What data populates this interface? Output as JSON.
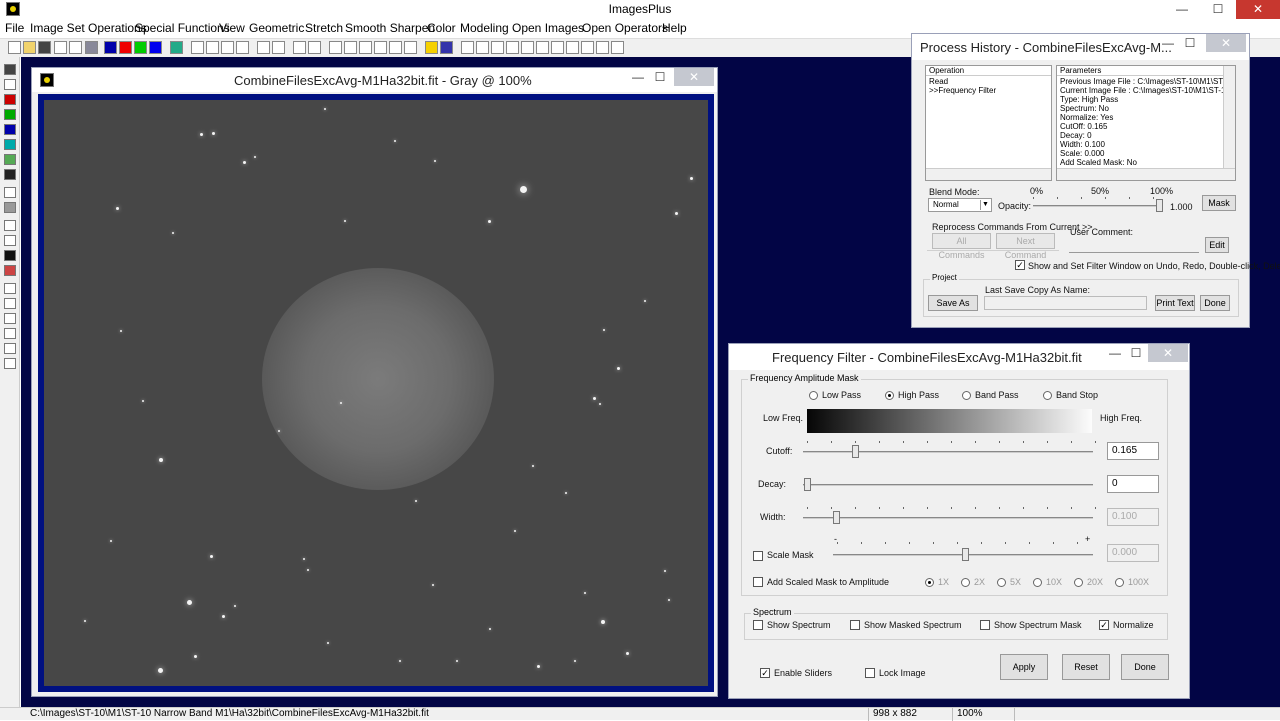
{
  "app": {
    "title": "ImagesPlus",
    "min": "—",
    "max": "☐",
    "close": "✕"
  },
  "menu": [
    "File",
    "Image Set Operations",
    "Special Functions",
    "View",
    "Geometric",
    "Stretch",
    "Smooth Sharpen",
    "Color",
    "Modeling",
    "Open Images",
    "Open Operators",
    "Help"
  ],
  "image_window": {
    "title": "CombineFilesExcAvg-M1Ha32bit.fit - Gray @ 100%",
    "min": "—",
    "max": "☐",
    "close": "✕"
  },
  "process_history": {
    "title": "Process History - CombineFilesExcAvg-M...",
    "min": "—",
    "max": "☐",
    "close": "✕",
    "operation_header": "Operation",
    "operations": [
      "Read",
      ">>Frequency Filter"
    ],
    "parameters_header": "Parameters",
    "parameters": [
      "Previous Image File : C:\\Images\\ST-10\\M1\\ST-10 N",
      "Current Image File : C:\\Images\\ST-10\\M1\\ST-10 N",
      "Type: High Pass",
      "Spectrum: No",
      "Normalize: Yes",
      "CutOff: 0.165",
      "Decay: 0",
      "Width: 0.100",
      "Scale: 0.000",
      "Add Scaled Mask: No"
    ],
    "blend_mode_label": "Blend Mode:",
    "blend_mode_value": "Normal",
    "opacity_label": "Opacity:",
    "opacity_scale": [
      "0%",
      "50%",
      "100%"
    ],
    "opacity_value": "1.000",
    "opacity_fraction": 1.0,
    "mask_button": "Mask",
    "reprocess_label": "Reprocess Commands From Current >>",
    "all_commands": "All Commands",
    "next_command": "Next Command",
    "user_comment_label": "User Comment:",
    "edit_button": "Edit",
    "show_set_filter_label": "Show and Set Filter Window on Undo, Redo, Double-click, Delete",
    "project_label": "Project",
    "last_save_label": "Last Save Copy As Name:",
    "save_as": "Save As",
    "print_text": "Print Text",
    "done": "Done"
  },
  "frequency_filter": {
    "title": "Frequency Filter - CombineFilesExcAvg-M1Ha32bit.fit",
    "min": "—",
    "max": "☐",
    "close": "✕",
    "mask_group_label": "Frequency Amplitude Mask",
    "filter_types": [
      "Low Pass",
      "High Pass",
      "Band Pass",
      "Band Stop"
    ],
    "selected_type": "High Pass",
    "low_freq_label": "Low Freq.",
    "high_freq_label": "High Freq.",
    "cutoff_label": "Cutoff:",
    "cutoff_value": "0.165",
    "cutoff_fraction": 0.165,
    "decay_label": "Decay:",
    "decay_value": "0",
    "decay_fraction": 0.0,
    "width_label": "Width:",
    "width_value": "0.100",
    "width_fraction": 0.1,
    "scale_mask_label": "Scale Mask",
    "scale_value": "0.000",
    "scale_fraction": 0.5,
    "scale_minus": "-",
    "scale_plus": "+",
    "add_scaled_label": "Add Scaled Mask to Amplitude",
    "multipliers": [
      "1X",
      "2X",
      "5X",
      "10X",
      "20X",
      "100X"
    ],
    "spectrum_group_label": "Spectrum",
    "show_spectrum": "Show Spectrum",
    "show_masked_spectrum": "Show Masked Spectrum",
    "show_spectrum_mask": "Show Spectrum Mask",
    "normalize": "Normalize",
    "enable_sliders": "Enable Sliders",
    "lock_image": "Lock Image",
    "apply": "Apply",
    "reset": "Reset",
    "done": "Done",
    "check_mark": "✓"
  },
  "status": {
    "path": "C:\\Images\\ST-10\\M1\\ST-10 Narrow Band M1\\Ha\\32bit\\CombineFilesExcAvg-M1Ha32bit.fit",
    "dimensions": "998 x 882",
    "zoom": "100%"
  }
}
